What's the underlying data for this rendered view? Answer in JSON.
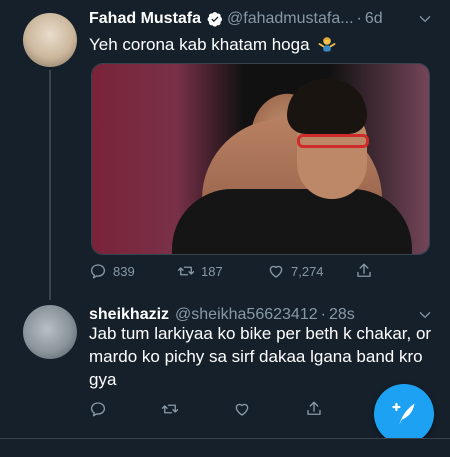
{
  "tweet1": {
    "name": "Fahad Mustafa",
    "handle": "@fahadmustafa...",
    "time": "6d",
    "text": "Yeh corona kab khatam hoga",
    "emoji": "person-shrugging",
    "reply_count": "839",
    "retweet_count": "187",
    "like_count": "7,274"
  },
  "tweet2": {
    "name": "sheikhaziz",
    "handle": "@sheikha56623412",
    "time": "28s",
    "text": "Jab tum larkiyaa ko bike per beth k chakar, or mardo ko pichy sa sirf dakaa lgana band kro gya"
  },
  "separator": "·",
  "colors": {
    "background": "#15202b",
    "accent": "#1da1f2",
    "secondary_text": "#8899a6"
  },
  "icons": {
    "verified": "verified-badge-icon",
    "reply": "reply-icon",
    "retweet": "retweet-icon",
    "like": "heart-icon",
    "share": "share-icon",
    "more": "chevron-down-icon",
    "compose": "compose-feather-icon"
  }
}
